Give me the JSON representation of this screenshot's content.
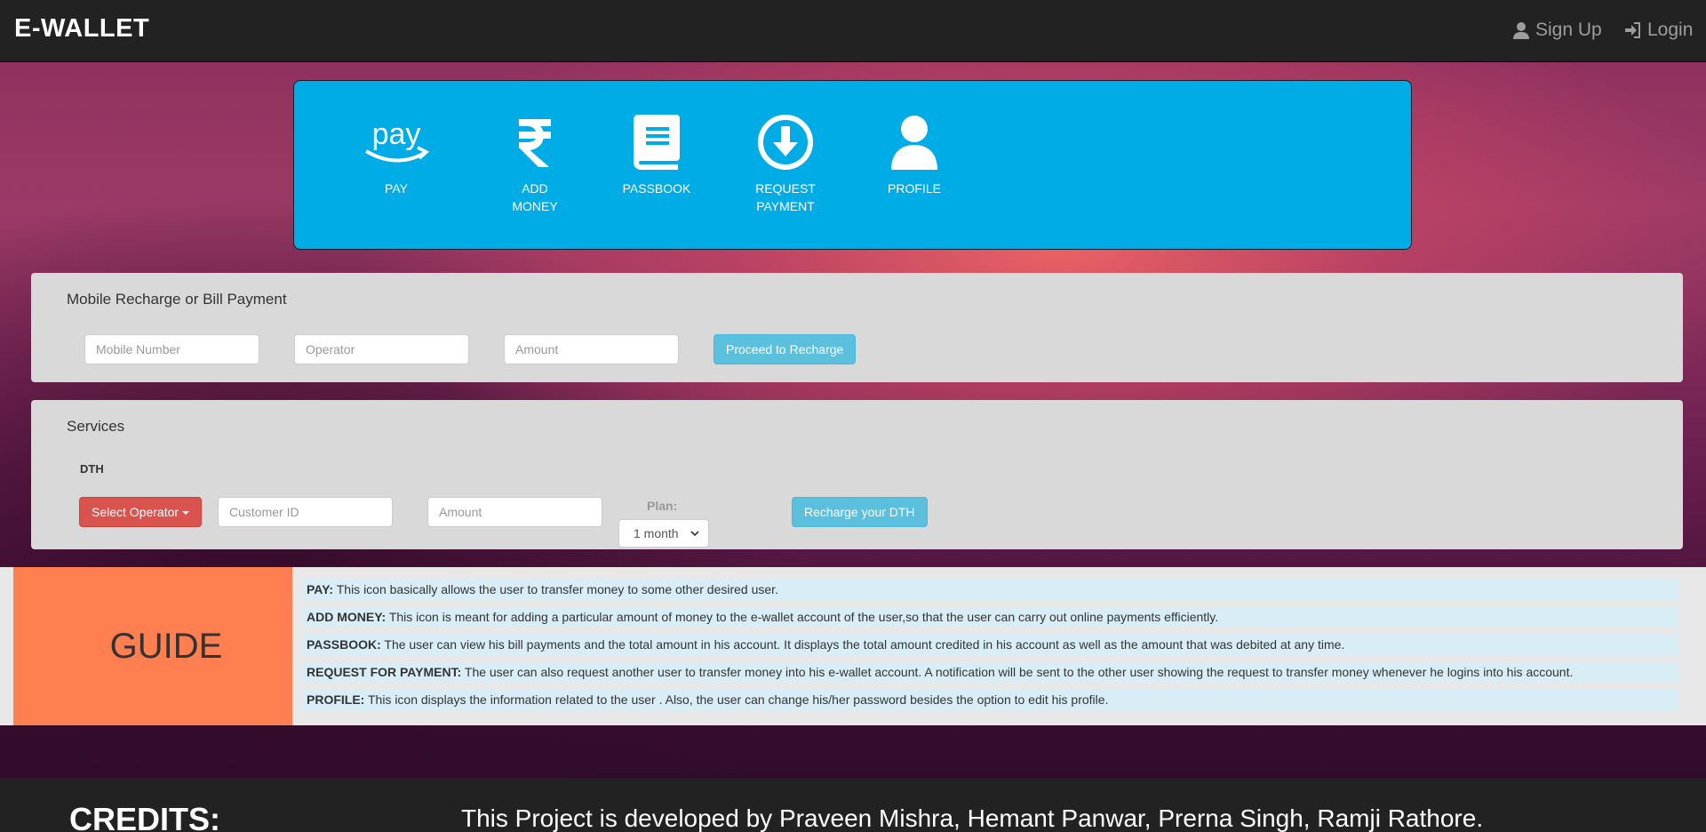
{
  "navbar": {
    "brand": "E-WALLET",
    "signup_label": "Sign Up",
    "login_label": "Login",
    "signup_icon": "user-icon",
    "login_icon": "log-in-icon"
  },
  "actions": [
    {
      "label": "PAY",
      "icon": "amazon-pay-icon",
      "icon_text": "pay"
    },
    {
      "label": "ADD MONEY",
      "icon": "rupee-icon"
    },
    {
      "label": "PASSBOOK",
      "icon": "book-icon"
    },
    {
      "label": "REQUEST PAYMENT",
      "icon": "download-circle-icon"
    },
    {
      "label": "PROFILE",
      "icon": "user-icon"
    }
  ],
  "recharge": {
    "title": "Mobile Recharge or Bill Payment",
    "mobile_placeholder": "Mobile Number",
    "operator_placeholder": "Operator",
    "amount_placeholder": "Amount",
    "button": "Proceed to Recharge"
  },
  "services": {
    "title": "Services",
    "dth_label": "DTH",
    "select_operator": "Select Operator",
    "customer_placeholder": "Customer ID",
    "amount_placeholder": "Amount",
    "plan_label": "Plan:",
    "plan_value": "1 month",
    "button": "Recharge your DTH"
  },
  "guide": {
    "title": "GUIDE",
    "items": [
      {
        "term": "PAY:",
        "text": " This icon basically allows the user to transfer money to some other desired user."
      },
      {
        "term": "ADD MONEY:",
        "text": " This icon is meant for adding a particular amount of money to the e-wallet account of the user,so that the user can carry out online payments efficiently."
      },
      {
        "term": "PASSBOOK:",
        "text": " The user can view his bill payments and the total amount in his account. It displays the total amount credited in his account as well as the amount that was debited at any time."
      },
      {
        "term": "REQUEST FOR PAYMENT:",
        "text": " The user can also request another user to transfer money into his e-wallet account. A notification will be sent to the other user showing the request to transfer money whenever he logins into his account."
      },
      {
        "term": "PROFILE:",
        "text": " This icon displays the information related to the user . Also, the user can change his/her password besides the option to edit his profile."
      }
    ]
  },
  "footer": {
    "credits_title": "CREDITS:",
    "credits_text": "This Project is developed by Praveen Mishra, Hemant Panwar, Prerna Singh, Ramji Rathore."
  },
  "colors": {
    "navbar": "#222222",
    "action_box": "#00ace6",
    "panel": "#d9d9d9",
    "info_button": "#5bc0de",
    "danger_button": "#d9534f",
    "guide_box": "#ff7f50",
    "guide_item": "#d9edf7"
  }
}
